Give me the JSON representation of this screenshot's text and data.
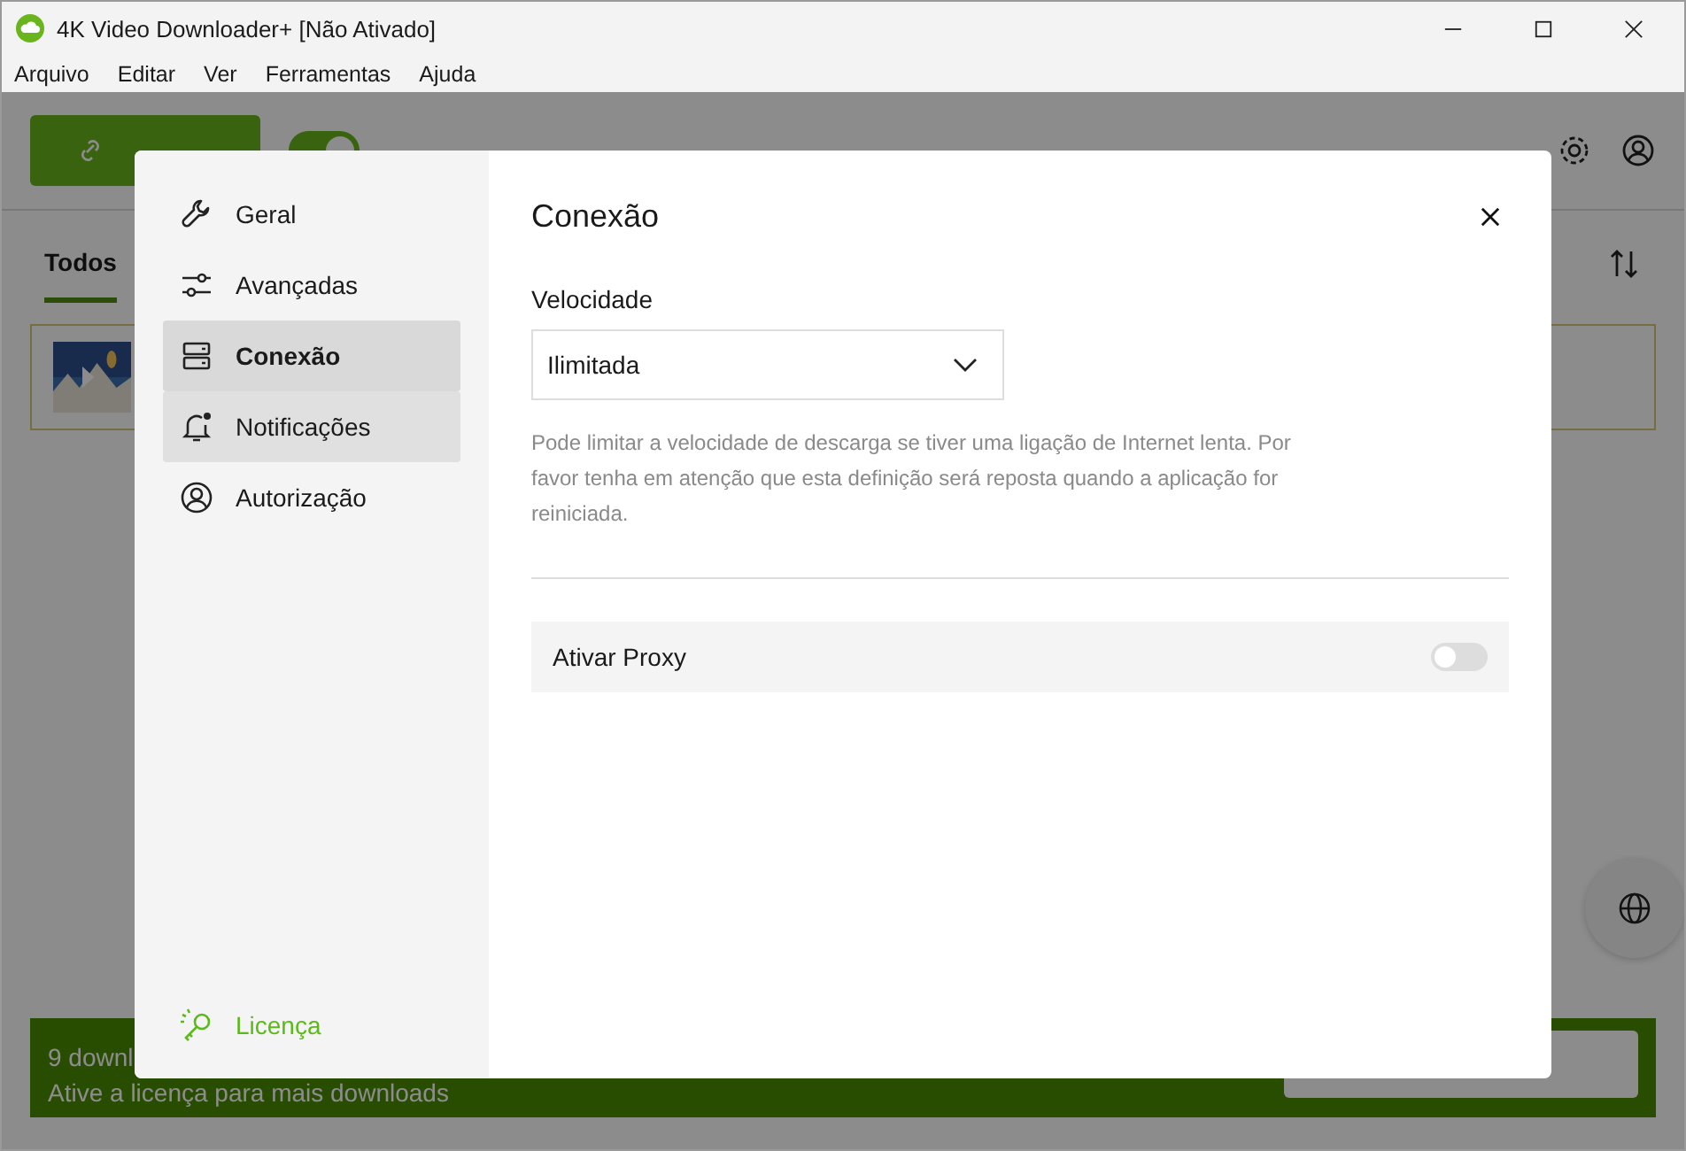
{
  "window": {
    "title": "4K Video Downloader+ [Não Ativado]"
  },
  "menu": [
    "Arquivo",
    "Editar",
    "Ver",
    "Ferramentas",
    "Ajuda"
  ],
  "toolbar": {
    "smart_mode_on": true
  },
  "tabs": [
    {
      "label": "Todos",
      "selected": true
    }
  ],
  "banner": {
    "title": "9 downl",
    "subtitle": "Ative a licença para mais downloads"
  },
  "dialog": {
    "sidebar": [
      {
        "label": "Geral",
        "selected": false,
        "hovered": false
      },
      {
        "label": "Avançadas",
        "selected": false,
        "hovered": false
      },
      {
        "label": "Conexão",
        "selected": true,
        "hovered": false
      },
      {
        "label": "Notificações",
        "selected": false,
        "hovered": true
      },
      {
        "label": "Autorização",
        "selected": false,
        "hovered": false
      }
    ],
    "license": "Licença",
    "title": "Conexão",
    "speed_label": "Velocidade",
    "speed_value": "Ilimitada",
    "speed_help": "Pode limitar a velocidade de descarga se tiver uma ligação de Internet lenta. Por favor tenha em atenção que esta definição será reposta quando a aplicação for reiniciada.",
    "proxy": {
      "label": "Ativar Proxy",
      "on": false
    }
  }
}
